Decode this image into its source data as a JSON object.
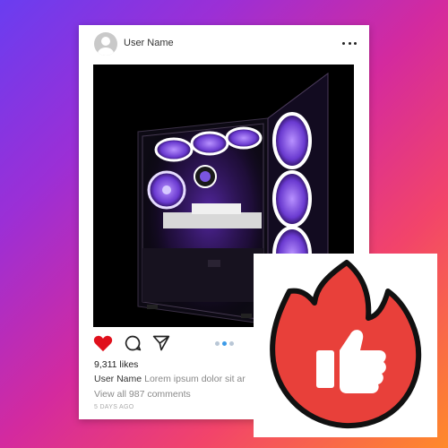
{
  "post": {
    "username": "User Name",
    "likes": "9,311 likes",
    "caption_user": "User Name",
    "caption_text": "Lorem ipsum dolor sit ar",
    "comments_link": "View all 987 comments",
    "timestamp": "5 DAYS AGO",
    "carousel": {
      "count": 3,
      "active_index": 1
    }
  },
  "icons": {
    "header_avatar": "user-avatar-icon",
    "header_menu": "more-horizontal-icon",
    "like": "heart-filled-icon",
    "comment": "comment-bubble-icon",
    "share": "send-paper-plane-icon",
    "overlay": "fire-thumbs-up-icon"
  },
  "colors": {
    "like_heart": "#e0101c",
    "fire_red": "#e8403a",
    "carousel_active": "#3c9be8",
    "case_accent": "#7b4fe0"
  }
}
